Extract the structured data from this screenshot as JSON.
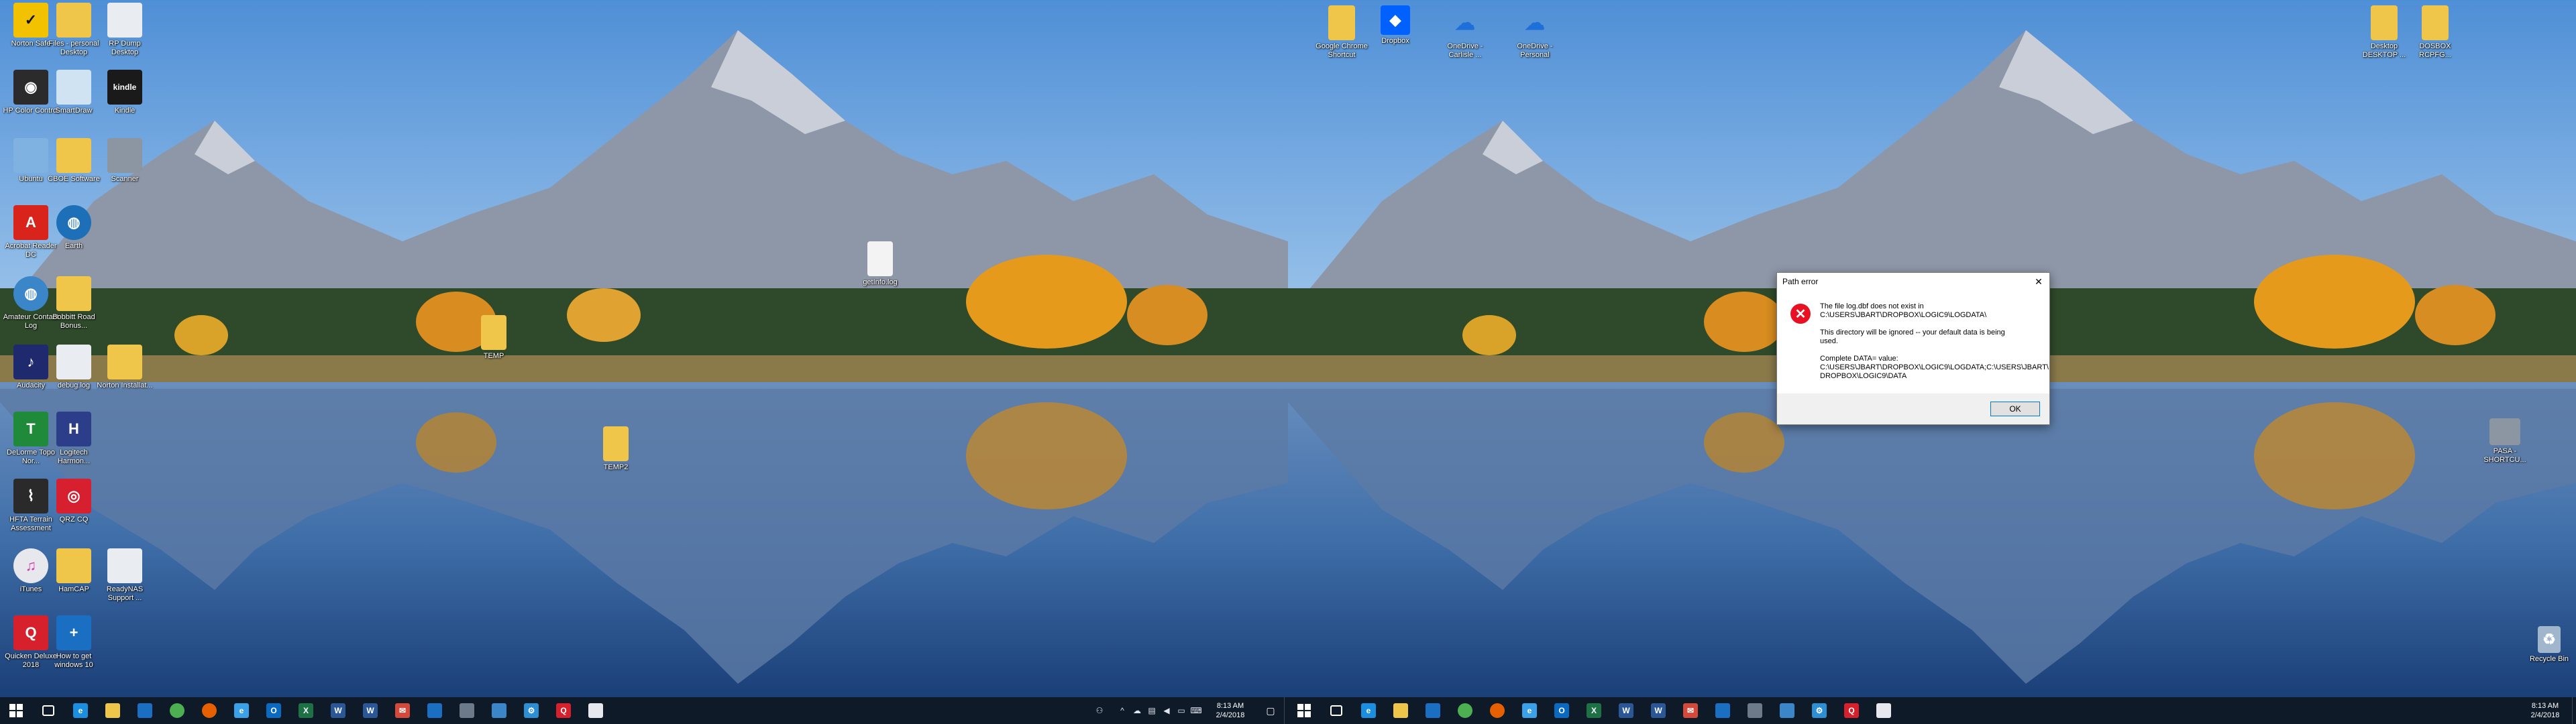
{
  "left_monitor": {
    "desktop_icons": [
      {
        "label": "Norton Safe",
        "icon": "norton-icon",
        "color": "#f2c200"
      },
      {
        "label": "Files - personal Desktop",
        "icon": "folder-icon",
        "color": "#f0c64a"
      },
      {
        "label": "RP Dump Desktop",
        "icon": "document-icon",
        "color": "#e9edf2"
      },
      {
        "label": "HP Color Control",
        "icon": "color-wheel-icon",
        "color": "#2b2b2b"
      },
      {
        "label": "SmartDraw",
        "icon": "document-icon",
        "color": "#cfe3f3"
      },
      {
        "label": "Kindle",
        "icon": "kindle-icon",
        "color": "#1a1a1a"
      },
      {
        "label": "Ubuntu",
        "icon": "ubuntu-icon",
        "color": "#7fb2e0"
      },
      {
        "label": "CBOE Software",
        "icon": "folder-icon",
        "color": "#f0c64a"
      },
      {
        "label": "Scanner",
        "icon": "scanner-icon",
        "color": "#8c96a3"
      },
      {
        "label": "Acrobat Reader DC",
        "icon": "acrobat-icon",
        "color": "#d9241b"
      },
      {
        "label": "Earth",
        "icon": "globe-icon",
        "color": "#1d6fb8"
      },
      {
        "label": "Amateur Contact Log",
        "icon": "globe-icon",
        "color": "#3a86c8"
      },
      {
        "label": "Bobbitt Road Bonus...",
        "icon": "folder-icon",
        "color": "#f0c64a"
      },
      {
        "label": "Audacity",
        "icon": "audacity-icon",
        "color": "#1f2a6e"
      },
      {
        "label": "debug.log",
        "icon": "document-icon",
        "color": "#e9edf2"
      },
      {
        "label": "Norton Installat...",
        "icon": "folder-icon",
        "color": "#f0c64a"
      },
      {
        "label": "DeLorme Topo Nor...",
        "icon": "topo-icon",
        "color": "#1f8a3a"
      },
      {
        "label": "Logitech Harmon...",
        "icon": "logitech-icon",
        "color": "#2c3e8a"
      },
      {
        "label": "HFTA Terrain Assessment",
        "icon": "hfta-icon",
        "color": "#2a2a2a"
      },
      {
        "label": "QRZ CQ",
        "icon": "camera-icon",
        "color": "#d62030"
      },
      {
        "label": "iTunes",
        "icon": "itunes-icon",
        "color": "#e7e7ee"
      },
      {
        "label": "HamCAP",
        "icon": "folder-icon",
        "color": "#f0c64a"
      },
      {
        "label": "ReadyNAS Support ...",
        "icon": "document-icon",
        "color": "#e9edf2"
      },
      {
        "label": "Quicken Deluxe 2018",
        "icon": "quicken-icon",
        "color": "#d6202c"
      },
      {
        "label": "How to get windows 10",
        "icon": "plus-icon",
        "color": "#1b6fc2"
      }
    ],
    "center_icons": [
      {
        "label": "getInfo.log",
        "icon": "document-icon",
        "color": "#f3f3f3"
      },
      {
        "label": "TEMP",
        "icon": "folder-icon",
        "color": "#f0c64a"
      },
      {
        "label": "TEMP2",
        "icon": "folder-icon",
        "color": "#f0c64a"
      }
    ],
    "taskbar": {
      "clock_time": "8:13 AM",
      "clock_date": "2/4/2018"
    }
  },
  "right_monitor": {
    "desktop_icons": [
      {
        "label": "Google Chrome Shortcut",
        "icon": "folder-icon",
        "color": "#f0c64a"
      },
      {
        "label": "Dropbox",
        "icon": "dropbox-icon",
        "color": "#0061fe"
      },
      {
        "label": "OneDrive - Carlisle ...",
        "icon": "onedrive-icon",
        "color": "#1e6fd9"
      },
      {
        "label": "OneDrive - Personal",
        "icon": "onedrive-icon",
        "color": "#1e6fd9"
      },
      {
        "label": "Desktop DESKTOP ...",
        "icon": "folder-icon",
        "color": "#f0c64a"
      },
      {
        "label": "DOSBOX RCPFG...",
        "icon": "folder-icon",
        "color": "#f0c64a"
      },
      {
        "label": "PASA - SHORTCU...",
        "icon": "scanner-icon",
        "color": "#8c96a3"
      },
      {
        "label": "Recycle Bin",
        "icon": "recycle-bin-icon",
        "color": "#9fb6cc"
      }
    ],
    "dialog": {
      "title": "Path error",
      "line1": "The file log.dbf does not exist in",
      "line2": "C:\\USERS\\JBART\\DROPBOX\\LOGIC9\\LOGDATA\\",
      "line3": "This directory will be ignored -- your default data is being",
      "line4": "used.",
      "line5": "Complete DATA= value:",
      "line6": "C:\\USERS\\JBART\\DROPBOX\\LOGIC9\\LOGDATA;C:\\USERS\\JBART\\",
      "line7": "DROPBOX\\LOGIC9\\DATA",
      "ok_label": "OK"
    },
    "taskbar": {
      "clock_time": "8:13 AM",
      "clock_date": "2/4/2018"
    }
  },
  "taskbar_apps": [
    {
      "name": "task-view-icon",
      "color": "#ffffff"
    },
    {
      "name": "edge-icon",
      "color": "#1a8fe0"
    },
    {
      "name": "file-explorer-icon",
      "color": "#f0c64a"
    },
    {
      "name": "store-icon",
      "color": "#1b6fc2"
    },
    {
      "name": "chrome-icon",
      "color": "#4caf50"
    },
    {
      "name": "firefox-icon",
      "color": "#e66000"
    },
    {
      "name": "ie-icon",
      "color": "#3aa0e8"
    },
    {
      "name": "outlook-icon",
      "color": "#0a6ac2"
    },
    {
      "name": "excel-icon",
      "color": "#1e7145"
    },
    {
      "name": "word-icon",
      "color": "#2b5797"
    },
    {
      "name": "word-icon",
      "color": "#2b5797"
    },
    {
      "name": "mail-icon",
      "color": "#d34a3a"
    },
    {
      "name": "calendar-icon",
      "color": "#1b6fc2"
    },
    {
      "name": "calculator-icon",
      "color": "#6c7a89"
    },
    {
      "name": "snipping-tool-icon",
      "color": "#3a86c8"
    },
    {
      "name": "settings-icon",
      "color": "#2c8fd4"
    },
    {
      "name": "quicken-icon",
      "color": "#d6202c"
    },
    {
      "name": "photos-icon",
      "color": "#e7e7ee"
    }
  ]
}
